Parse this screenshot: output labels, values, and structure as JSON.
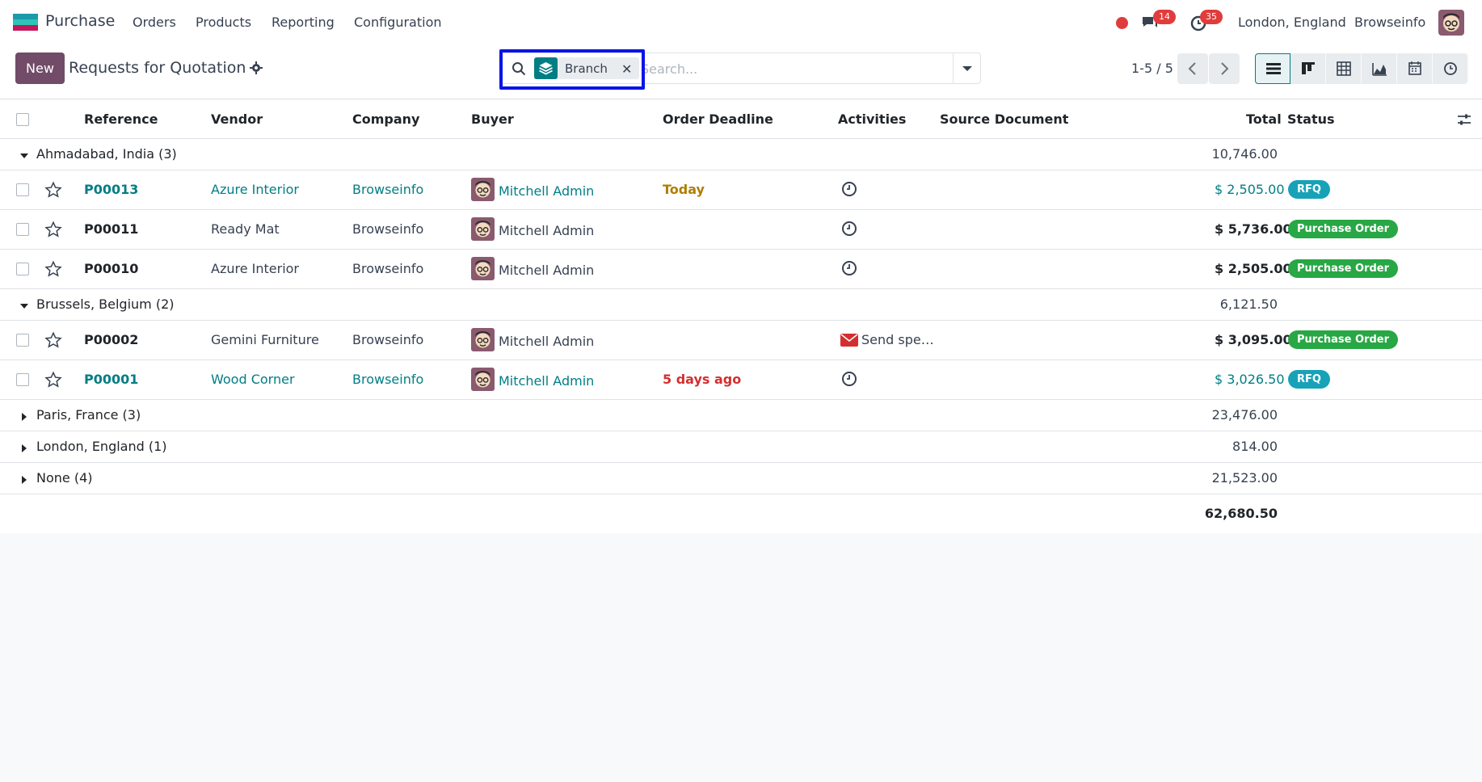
{
  "navbar": {
    "app_name": "Purchase",
    "menu": [
      "Orders",
      "Products",
      "Reporting",
      "Configuration"
    ],
    "messages_count": "14",
    "activities_count": "35",
    "branch": "London, England",
    "company": "Browseinfo"
  },
  "control": {
    "new_label": "New",
    "title": "Requests for Quotation",
    "facet_label": "Branch",
    "search_placeholder": "Search...",
    "pager": "1-5 / 5"
  },
  "table": {
    "headers": [
      "Reference",
      "Vendor",
      "Company",
      "Buyer",
      "Order Deadline",
      "Activities",
      "Source Document",
      "Total",
      "Status"
    ],
    "groups": [
      {
        "label": "Ahmadabad, India (3)",
        "total": "10,746.00",
        "rows": [
          {
            "reference": "P00013",
            "vendor": "Azure Interior",
            "company": "Browseinfo",
            "buyer": "Mitchell Admin",
            "deadline": "Today",
            "activity": "",
            "total": "$ 2,505.00",
            "status": "RFQ"
          },
          {
            "reference": "P00011",
            "vendor": "Ready Mat",
            "company": "Browseinfo",
            "buyer": "Mitchell Admin",
            "deadline": "",
            "activity": "",
            "total": "$ 5,736.00",
            "status": "Purchase Order"
          },
          {
            "reference": "P00010",
            "vendor": "Azure Interior",
            "company": "Browseinfo",
            "buyer": "Mitchell Admin",
            "deadline": "",
            "activity": "",
            "total": "$ 2,505.00",
            "status": "Purchase Order"
          }
        ]
      },
      {
        "label": "Brussels, Belgium (2)",
        "total": "6,121.50",
        "rows": [
          {
            "reference": "P00002",
            "vendor": "Gemini Furniture",
            "company": "Browseinfo",
            "buyer": "Mitchell Admin",
            "deadline": "",
            "activity": "Send spe…",
            "total": "$ 3,095.00",
            "status": "Purchase Order"
          },
          {
            "reference": "P00001",
            "vendor": "Wood Corner",
            "company": "Browseinfo",
            "buyer": "Mitchell Admin",
            "deadline": "5 days ago",
            "activity": "",
            "total": "$ 3,026.50",
            "status": "RFQ"
          }
        ]
      },
      {
        "label": "Paris, France (3)",
        "total": "23,476.00"
      },
      {
        "label": "London, England (1)",
        "total": "814.00"
      },
      {
        "label": "None (4)",
        "total": "21,523.00"
      }
    ],
    "grand_total": "62,680.50"
  },
  "colors": {
    "brand": "#714b67",
    "link": "#017e84",
    "rfq": "#17a2b8",
    "po": "#28a745",
    "today": "#b07d00",
    "overdue": "#d32f2f"
  }
}
